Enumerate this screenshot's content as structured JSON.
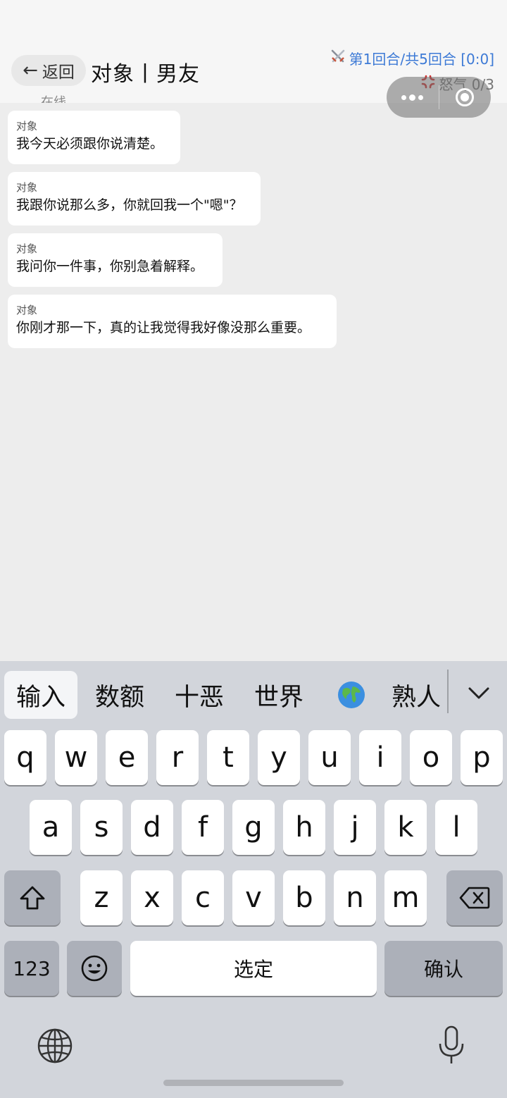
{
  "header": {
    "back_label": "返回",
    "title": "对象丨男友",
    "round_info": "第1回合/共5回合 [0:0]",
    "anger_info": "怒气 0/3",
    "status": "在线"
  },
  "messages": [
    {
      "sender": "对象",
      "text": "我今天必须跟你说清楚。"
    },
    {
      "sender": "对象",
      "text": "我跟你说那么多，你就回我一个\"嗯\"？"
    },
    {
      "sender": "对象",
      "text": "我问你一件事，你别急着解释。"
    },
    {
      "sender": "对象",
      "text": "你刚才那一下，真的让我觉得我好像没那么重要。"
    }
  ],
  "keyboard": {
    "candidates": [
      "输入",
      "数额",
      "十恶",
      "世界",
      "🌍",
      "熟人"
    ],
    "row1": [
      "q",
      "w",
      "e",
      "r",
      "t",
      "y",
      "u",
      "i",
      "o",
      "p"
    ],
    "row2": [
      "a",
      "s",
      "d",
      "f",
      "g",
      "h",
      "j",
      "k",
      "l"
    ],
    "row3": [
      "z",
      "x",
      "c",
      "v",
      "b",
      "n",
      "m"
    ],
    "numbers_label": "123",
    "space_label": "选定",
    "confirm_label": "确认"
  },
  "icons": {
    "back": "arrow-left-icon",
    "round": "crossed-swords-icon",
    "anger": "anger-symbol-icon",
    "more": "more-dots-icon",
    "close": "target-close-icon",
    "shift": "shift-icon",
    "delete": "backspace-icon",
    "emoji": "emoji-icon",
    "globe": "globe-icon",
    "mic": "microphone-icon",
    "collapse": "chevron-down-icon"
  }
}
